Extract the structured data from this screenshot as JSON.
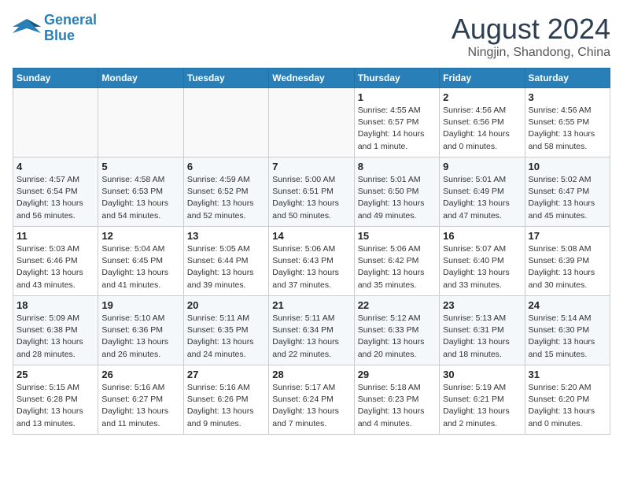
{
  "header": {
    "logo_line1": "General",
    "logo_line2": "Blue",
    "month": "August 2024",
    "location": "Ningjin, Shandong, China"
  },
  "weekdays": [
    "Sunday",
    "Monday",
    "Tuesday",
    "Wednesday",
    "Thursday",
    "Friday",
    "Saturday"
  ],
  "weeks": [
    [
      {
        "day": "",
        "info": ""
      },
      {
        "day": "",
        "info": ""
      },
      {
        "day": "",
        "info": ""
      },
      {
        "day": "",
        "info": ""
      },
      {
        "day": "1",
        "info": "Sunrise: 4:55 AM\nSunset: 6:57 PM\nDaylight: 14 hours\nand 1 minute."
      },
      {
        "day": "2",
        "info": "Sunrise: 4:56 AM\nSunset: 6:56 PM\nDaylight: 14 hours\nand 0 minutes."
      },
      {
        "day": "3",
        "info": "Sunrise: 4:56 AM\nSunset: 6:55 PM\nDaylight: 13 hours\nand 58 minutes."
      }
    ],
    [
      {
        "day": "4",
        "info": "Sunrise: 4:57 AM\nSunset: 6:54 PM\nDaylight: 13 hours\nand 56 minutes."
      },
      {
        "day": "5",
        "info": "Sunrise: 4:58 AM\nSunset: 6:53 PM\nDaylight: 13 hours\nand 54 minutes."
      },
      {
        "day": "6",
        "info": "Sunrise: 4:59 AM\nSunset: 6:52 PM\nDaylight: 13 hours\nand 52 minutes."
      },
      {
        "day": "7",
        "info": "Sunrise: 5:00 AM\nSunset: 6:51 PM\nDaylight: 13 hours\nand 50 minutes."
      },
      {
        "day": "8",
        "info": "Sunrise: 5:01 AM\nSunset: 6:50 PM\nDaylight: 13 hours\nand 49 minutes."
      },
      {
        "day": "9",
        "info": "Sunrise: 5:01 AM\nSunset: 6:49 PM\nDaylight: 13 hours\nand 47 minutes."
      },
      {
        "day": "10",
        "info": "Sunrise: 5:02 AM\nSunset: 6:47 PM\nDaylight: 13 hours\nand 45 minutes."
      }
    ],
    [
      {
        "day": "11",
        "info": "Sunrise: 5:03 AM\nSunset: 6:46 PM\nDaylight: 13 hours\nand 43 minutes."
      },
      {
        "day": "12",
        "info": "Sunrise: 5:04 AM\nSunset: 6:45 PM\nDaylight: 13 hours\nand 41 minutes."
      },
      {
        "day": "13",
        "info": "Sunrise: 5:05 AM\nSunset: 6:44 PM\nDaylight: 13 hours\nand 39 minutes."
      },
      {
        "day": "14",
        "info": "Sunrise: 5:06 AM\nSunset: 6:43 PM\nDaylight: 13 hours\nand 37 minutes."
      },
      {
        "day": "15",
        "info": "Sunrise: 5:06 AM\nSunset: 6:42 PM\nDaylight: 13 hours\nand 35 minutes."
      },
      {
        "day": "16",
        "info": "Sunrise: 5:07 AM\nSunset: 6:40 PM\nDaylight: 13 hours\nand 33 minutes."
      },
      {
        "day": "17",
        "info": "Sunrise: 5:08 AM\nSunset: 6:39 PM\nDaylight: 13 hours\nand 30 minutes."
      }
    ],
    [
      {
        "day": "18",
        "info": "Sunrise: 5:09 AM\nSunset: 6:38 PM\nDaylight: 13 hours\nand 28 minutes."
      },
      {
        "day": "19",
        "info": "Sunrise: 5:10 AM\nSunset: 6:36 PM\nDaylight: 13 hours\nand 26 minutes."
      },
      {
        "day": "20",
        "info": "Sunrise: 5:11 AM\nSunset: 6:35 PM\nDaylight: 13 hours\nand 24 minutes."
      },
      {
        "day": "21",
        "info": "Sunrise: 5:11 AM\nSunset: 6:34 PM\nDaylight: 13 hours\nand 22 minutes."
      },
      {
        "day": "22",
        "info": "Sunrise: 5:12 AM\nSunset: 6:33 PM\nDaylight: 13 hours\nand 20 minutes."
      },
      {
        "day": "23",
        "info": "Sunrise: 5:13 AM\nSunset: 6:31 PM\nDaylight: 13 hours\nand 18 minutes."
      },
      {
        "day": "24",
        "info": "Sunrise: 5:14 AM\nSunset: 6:30 PM\nDaylight: 13 hours\nand 15 minutes."
      }
    ],
    [
      {
        "day": "25",
        "info": "Sunrise: 5:15 AM\nSunset: 6:28 PM\nDaylight: 13 hours\nand 13 minutes."
      },
      {
        "day": "26",
        "info": "Sunrise: 5:16 AM\nSunset: 6:27 PM\nDaylight: 13 hours\nand 11 minutes."
      },
      {
        "day": "27",
        "info": "Sunrise: 5:16 AM\nSunset: 6:26 PM\nDaylight: 13 hours\nand 9 minutes."
      },
      {
        "day": "28",
        "info": "Sunrise: 5:17 AM\nSunset: 6:24 PM\nDaylight: 13 hours\nand 7 minutes."
      },
      {
        "day": "29",
        "info": "Sunrise: 5:18 AM\nSunset: 6:23 PM\nDaylight: 13 hours\nand 4 minutes."
      },
      {
        "day": "30",
        "info": "Sunrise: 5:19 AM\nSunset: 6:21 PM\nDaylight: 13 hours\nand 2 minutes."
      },
      {
        "day": "31",
        "info": "Sunrise: 5:20 AM\nSunset: 6:20 PM\nDaylight: 13 hours\nand 0 minutes."
      }
    ]
  ]
}
